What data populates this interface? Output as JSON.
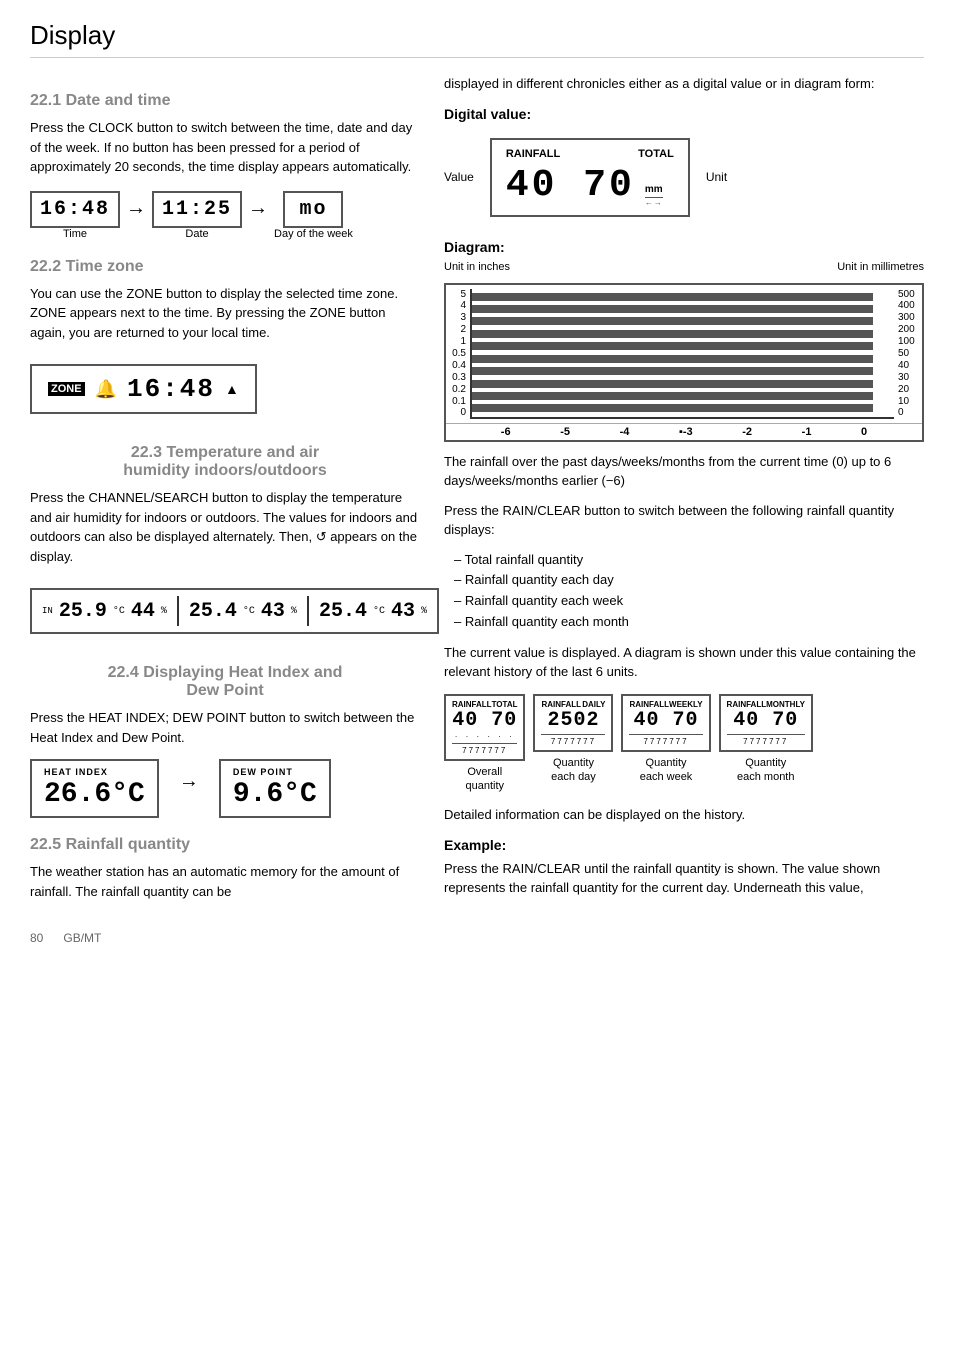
{
  "page": {
    "title": "Display",
    "footer_page": "80",
    "footer_locale": "GB/MT"
  },
  "section_221": {
    "heading": "22.1 Date and time",
    "body1": "Press the CLOCK button to switch between the time, date and day of the week. If no button has been pressed for a period of approximately 20 seconds, the time display appears automatically.",
    "time_value": "16:48",
    "date_value": "11:25",
    "day_value": "mo",
    "time_label": "Time",
    "date_label": "Date",
    "day_label": "Day of the week"
  },
  "section_222": {
    "heading": "22.2 Time zone",
    "body1": "You can use the ZONE button to display the selected time zone. ZONE appears next to the time. By pressing the ZONE button again, you are returned to your local time.",
    "zone_label": "ZONE",
    "zone_icon": "🔔",
    "zone_time": "16:48",
    "zone_arrow": "▲"
  },
  "section_223": {
    "heading_line1": "22.3 Temperature and air",
    "heading_line2": "humidity indoors/outdoors",
    "body1": "Press the CHANNEL/SEARCH button to display the temperature and air humidity for indoors or outdoors. The values for indoors and outdoors can also be displayed alternately. Then, ↺ appears on the display.",
    "temp1": "25.9",
    "hum1": "44",
    "temp2": "25.4",
    "hum2": "43",
    "temp3": "25.4",
    "hum3": "43"
  },
  "section_224": {
    "heading_line1": "22.4 Displaying Heat Index and",
    "heading_line2": "Dew Point",
    "body1": "Press the HEAT INDEX; DEW POINT button to switch between the Heat Index and Dew Point.",
    "heat_label": "HEAT INDEX",
    "heat_value": "26.6°C",
    "dew_label": "DEW POINT",
    "dew_value": "9.6°C",
    "arrow": "→"
  },
  "section_225": {
    "heading": "22.5 Rainfall quantity",
    "body1": "The weather station has an automatic memory for the amount of rainfall. The rainfall quantity can be"
  },
  "right_col": {
    "body_continue": "displayed in different chronicles either as a digital value or in diagram form:",
    "digital_heading": "Digital value:",
    "rainfall_label": "RAINFALL",
    "total_label": "TOTAL",
    "value_label": "Value",
    "unit_label": "Unit",
    "rainfall_value": "40 70",
    "rainfall_unit": "mm",
    "diagram_heading": "Diagram:",
    "unit_inches": "Unit in inches",
    "unit_mm": "Unit in millimetres",
    "y_left": [
      "5",
      "4",
      "3",
      "2",
      "1",
      "0.5",
      "0.4",
      "0.3",
      "0.2",
      "0.1",
      "0"
    ],
    "y_right": [
      "500",
      "400",
      "300",
      "200",
      "100",
      "50",
      "40",
      "30",
      "20",
      "10",
      "0"
    ],
    "x_labels": [
      "-6",
      "-5",
      "-4",
      "-3",
      "-2",
      "-1",
      "0"
    ],
    "chart_caption1": "The rainfall over the past days/weeks/months from the current time (0) up to 6 days/weeks/months earlier (−6)",
    "rain_clear_text1": "Press the RAIN/CLEAR button to switch between the following rainfall quantity displays:",
    "bullet_items": [
      "Total rainfall quantity",
      "Rainfall quantity each day",
      "Rainfall quantity each week",
      "Rainfall quantity each month"
    ],
    "current_value_text": "The current value is displayed. A diagram is shown under this value containing the relevant history of the last 6 units.",
    "small_rf": [
      {
        "top_left": "RAINFALL",
        "top_right": "TOTAL",
        "value": "40 70",
        "dots": "· · · · · ·",
        "bars": "7777777",
        "label_line1": "Overall",
        "label_line2": "quantity"
      },
      {
        "top_left": "RAINFALL",
        "top_right": "DAILY",
        "value": "2502",
        "dots": "",
        "bars": "7777777",
        "label_line1": "Quantity",
        "label_line2": "each day"
      },
      {
        "top_left": "RAINFALL",
        "top_right": "WEEKLY",
        "value": "40 70",
        "dots": "",
        "bars": "7777777",
        "label_line1": "Quantity",
        "label_line2": "each week"
      },
      {
        "top_left": "RAINFALL",
        "top_right": "MONTHLY",
        "value": "40 70",
        "dots": "",
        "bars": "7777777",
        "label_line1": "Quantity",
        "label_line2": "each month"
      }
    ],
    "detailed_text": "Detailed information can be displayed on the history.",
    "example_heading": "Example:",
    "example_text": "Press the RAIN/CLEAR until the rainfall quantity is shown. The value shown represents the rainfall quantity for the current day. Underneath this value,"
  }
}
